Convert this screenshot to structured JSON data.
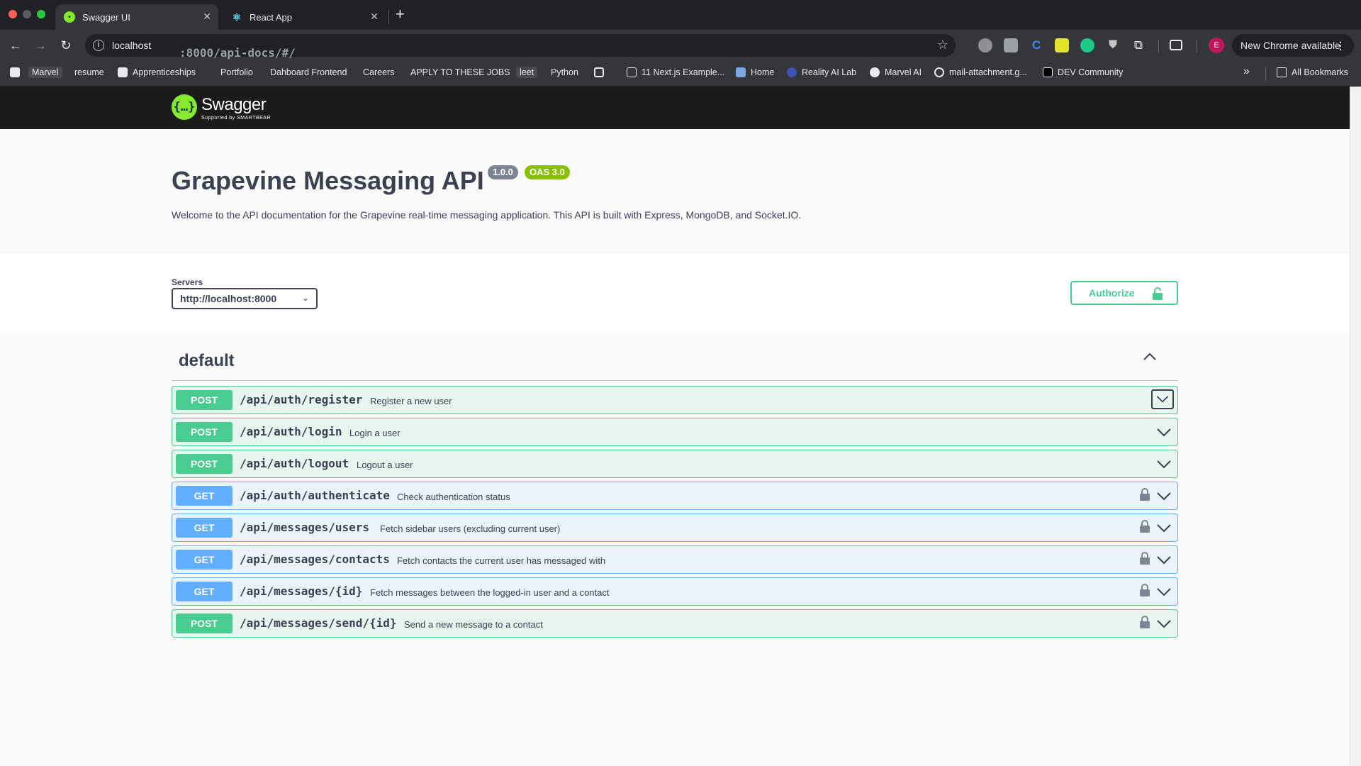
{
  "browser": {
    "tabs": [
      {
        "title": "Swagger UI",
        "active": true
      },
      {
        "title": "React App",
        "active": false
      }
    ],
    "new_tab": "+",
    "address": {
      "host": "localhost",
      "path": ":8000/api-docs/#/"
    },
    "new_chrome": "New Chrome available",
    "profile_initial": "E",
    "bookmarks": [
      "Marvel",
      "resume",
      "Apprenticeships",
      "Portfolio",
      "Dahboard Frontend",
      "Careers",
      "APPLY TO THESE JOBS",
      "leet",
      "Python",
      "11 Next.js Example...",
      "Home",
      "Reality AI Lab",
      "Marvel AI",
      "mail-attachment.g...",
      "DEV Community"
    ],
    "bookmarks_overflow": "»",
    "all_bookmarks": "All Bookmarks"
  },
  "swagger": {
    "logo_glyph": "{…}",
    "brand": "Swagger",
    "brand_sub": "Supported by SMARTBEAR",
    "title": "Grapevine Messaging API",
    "version": "1.0.0",
    "oas": "OAS 3.0",
    "description": "Welcome to the API documentation for the Grapevine real-time messaging application. This API is built with Express, MongoDB, and Socket.IO.",
    "servers_label": "Servers",
    "server_selected": "http://localhost:8000",
    "authorize_label": "Authorize",
    "tag": "default",
    "colors": {
      "post": "#49cc90",
      "get": "#61afe3",
      "authorize": "#49cc90",
      "topbar": "#1b1b1b",
      "logo": "#85ea2d"
    },
    "operations": [
      {
        "method": "POST",
        "path": "/api/auth/register",
        "summary": "Register a new user",
        "locked": false
      },
      {
        "method": "POST",
        "path": "/api/auth/login",
        "summary": "Login a user",
        "locked": false
      },
      {
        "method": "POST",
        "path": "/api/auth/logout",
        "summary": "Logout a user",
        "locked": false
      },
      {
        "method": "GET",
        "path": "/api/auth/authenticate",
        "summary": "Check authentication status",
        "locked": true
      },
      {
        "method": "GET",
        "path": "/api/messages/users",
        "summary": "Fetch sidebar users (excluding current user)",
        "locked": true
      },
      {
        "method": "GET",
        "path": "/api/messages/contacts",
        "summary": "Fetch contacts the current user has messaged with",
        "locked": true
      },
      {
        "method": "GET",
        "path": "/api/messages/{id}",
        "summary": "Fetch messages between the logged-in user and a contact",
        "locked": true
      },
      {
        "method": "POST",
        "path": "/api/messages/send/{id}",
        "summary": "Send a new message to a contact",
        "locked": true
      }
    ]
  }
}
